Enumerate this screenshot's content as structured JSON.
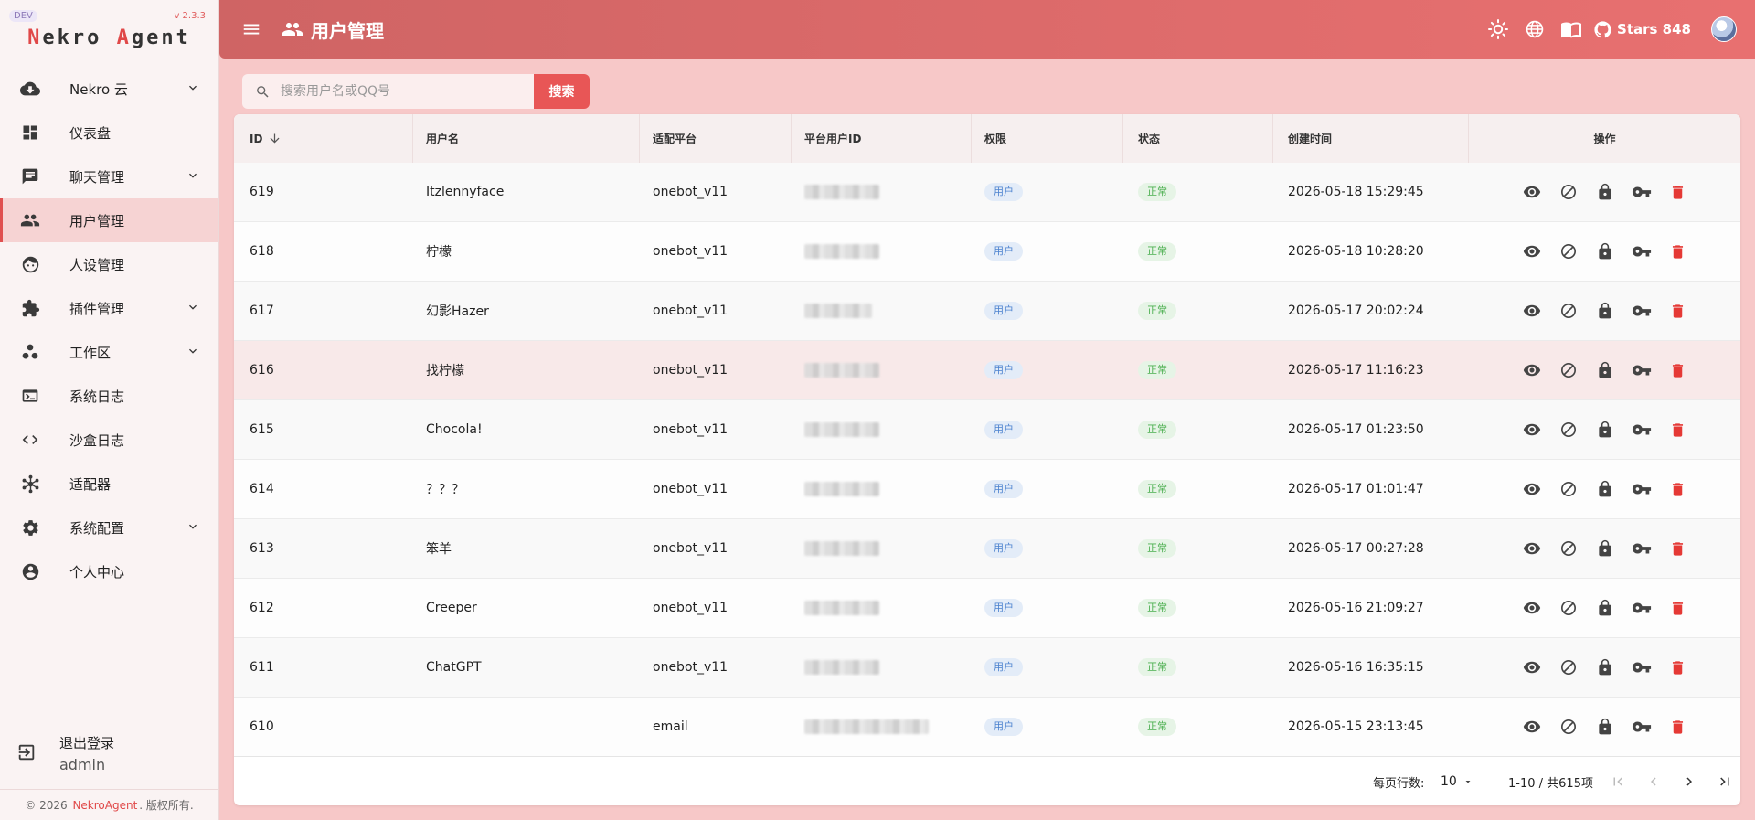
{
  "brand": {
    "dev_badge": "DEV",
    "version": "v 2.3.3",
    "logo_n": "N",
    "logo_ekro": "ekro ",
    "logo_a": "A",
    "logo_gent": "gent"
  },
  "sidebar": {
    "items": [
      {
        "label": "Nekro 云",
        "icon": "cloud-download-icon",
        "expandable": true
      },
      {
        "label": "仪表盘",
        "icon": "dashboard-icon",
        "expandable": false
      },
      {
        "label": "聊天管理",
        "icon": "chat-icon",
        "expandable": true
      },
      {
        "label": "用户管理",
        "icon": "people-icon",
        "expandable": false,
        "active": true
      },
      {
        "label": "人设管理",
        "icon": "face-icon",
        "expandable": false
      },
      {
        "label": "插件管理",
        "icon": "puzzle-icon",
        "expandable": true
      },
      {
        "label": "工作区",
        "icon": "bubbles-icon",
        "expandable": true
      },
      {
        "label": "系统日志",
        "icon": "terminal-icon",
        "expandable": false
      },
      {
        "label": "沙盒日志",
        "icon": "code-icon",
        "expandable": false
      },
      {
        "label": "适配器",
        "icon": "hub-icon",
        "expandable": false
      },
      {
        "label": "系统配置",
        "icon": "gear-icon",
        "expandable": true
      },
      {
        "label": "个人中心",
        "icon": "account-circle-icon",
        "expandable": false
      }
    ],
    "logout_label": "退出登录",
    "logout_user": "admin",
    "copyright_prefix": "© 2026",
    "copyright_link": "NekroAgent",
    "copyright_suffix": ". 版权所有."
  },
  "topbar": {
    "title": "用户管理",
    "stars_label": "Stars 848"
  },
  "search": {
    "placeholder": "搜索用户名或QQ号",
    "value": "",
    "button": "搜索"
  },
  "table": {
    "headers": {
      "id": "ID",
      "username": "用户名",
      "platform": "适配平台",
      "platform_user_id": "平台用户ID",
      "permission": "权限",
      "status": "状态",
      "created": "创建时间",
      "actions": "操作"
    },
    "sort_indicator": "arrow-down-icon",
    "rows": [
      {
        "id": "619",
        "username": "Itzlennyface",
        "platform": "onebot_v11",
        "permission": "用户",
        "status": "正常",
        "created": "2026-05-18 15:29:45"
      },
      {
        "id": "618",
        "username": "柠檬",
        "platform": "onebot_v11",
        "permission": "用户",
        "status": "正常",
        "created": "2026-05-18 10:28:20"
      },
      {
        "id": "617",
        "username": "幻影Hazer",
        "platform": "onebot_v11",
        "permission": "用户",
        "status": "正常",
        "created": "2026-05-17 20:02:24"
      },
      {
        "id": "616",
        "username": "找柠檬",
        "platform": "onebot_v11",
        "permission": "用户",
        "status": "正常",
        "created": "2026-05-17 11:16:23"
      },
      {
        "id": "615",
        "username": "Chocola!",
        "platform": "onebot_v11",
        "permission": "用户",
        "status": "正常",
        "created": "2026-05-17 01:23:50"
      },
      {
        "id": "614",
        "username": "？？？",
        "platform": "onebot_v11",
        "permission": "用户",
        "status": "正常",
        "created": "2026-05-17 01:01:47"
      },
      {
        "id": "613",
        "username": "笨羊",
        "platform": "onebot_v11",
        "permission": "用户",
        "status": "正常",
        "created": "2026-05-17 00:27:28"
      },
      {
        "id": "612",
        "username": "Creeper",
        "platform": "onebot_v11",
        "permission": "用户",
        "status": "正常",
        "created": "2026-05-16 21:09:27"
      },
      {
        "id": "611",
        "username": "ChatGPT",
        "platform": "onebot_v11",
        "permission": "用户",
        "status": "正常",
        "created": "2026-05-16 16:35:15"
      },
      {
        "id": "610",
        "username": "",
        "platform": "email",
        "permission": "用户",
        "status": "正常",
        "created": "2026-05-15 23:13:45"
      }
    ],
    "row_actions": [
      "eye-icon",
      "block-icon",
      "lock-icon",
      "key-icon",
      "delete-icon"
    ],
    "highlighted_row": "616"
  },
  "pagination": {
    "rows_per_page_label": "每页行数:",
    "rows_per_page": "10",
    "range": "1-10 / 共615项"
  },
  "colors": {
    "accent": "#e85656",
    "topbar_start": "#cf6464",
    "topbar_end": "#e87070",
    "delete": "#e53935"
  }
}
